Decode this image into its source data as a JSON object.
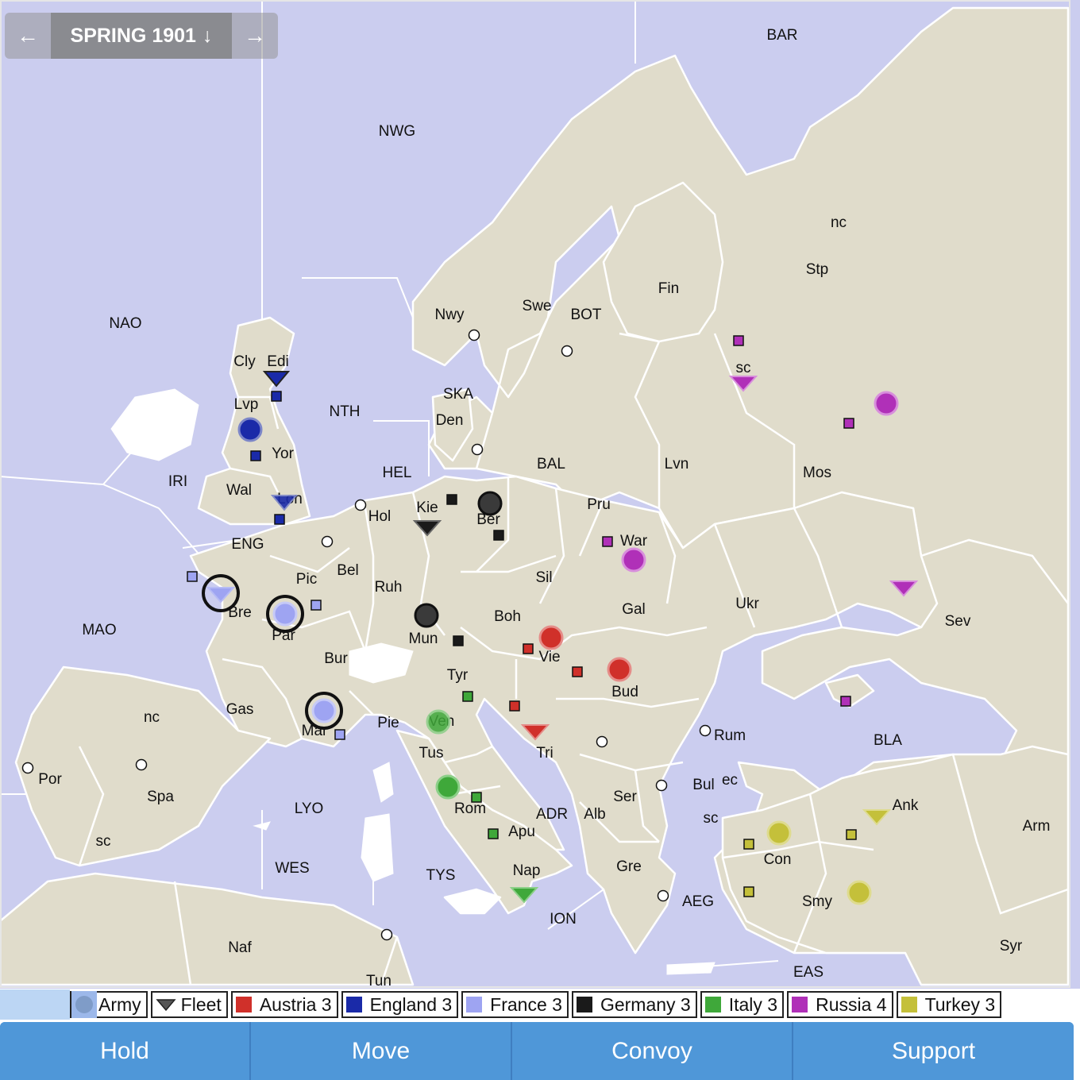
{
  "season": {
    "label": "SPRING 1901",
    "down_icon": "arrow-down-icon",
    "prev_icon": "arrow-left-icon",
    "next_icon": "arrow-right-icon"
  },
  "colors": {
    "sea": "#cbcdef",
    "land": "#e0dccb",
    "border": "#ffffff",
    "Austria": "#d0302a",
    "England": "#1a2aa8",
    "France": "#9ea4f2",
    "Germany": "#1a1a1a",
    "Italy": "#3fa83a",
    "Russia": "#b030b8",
    "Turkey": "#c4c03a"
  },
  "sea_labels": [
    "BAR",
    "NWG",
    "NAO",
    "NTH",
    "SKA",
    "HEL",
    "BAL",
    "BOT",
    "IRI",
    "ENG",
    "MAO",
    "LYO",
    "WES",
    "TYS",
    "ION",
    "ADR",
    "AEG",
    "BLA",
    "EAS"
  ],
  "land_labels": [
    "nc",
    "Stp",
    "Fin",
    "Nwy",
    "Swe",
    "sc",
    "Cly",
    "Edi",
    "Lvp",
    "Yor",
    "Den",
    "Wal",
    "Lon",
    "Hol",
    "Kie",
    "Ber",
    "Lvn",
    "Mos",
    "Pru",
    "War",
    "Pic",
    "Bel",
    "Ruh",
    "Sil",
    "Bre",
    "Par",
    "Mun",
    "Boh",
    "Gal",
    "Ukr",
    "Sev",
    "Bur",
    "Vie",
    "Tyr",
    "Bud",
    "Gas",
    "Mar",
    "Pie",
    "Ven",
    "Tri",
    "Rum",
    "nc",
    "Por",
    "Spa",
    "Tus",
    "Rom",
    "Ser",
    "Bul",
    "ec",
    "Apu",
    "Alb",
    "sc",
    "Ank",
    "Arm",
    "sc",
    "Con",
    "Nap",
    "Gre",
    "Smy",
    "Syr",
    "Naf",
    "Tun"
  ],
  "units": [
    {
      "type": "fleet",
      "power": "England",
      "province": "Edi"
    },
    {
      "type": "army",
      "power": "England",
      "province": "Lvp"
    },
    {
      "type": "fleet",
      "power": "England",
      "province": "Lon"
    },
    {
      "type": "fleet",
      "power": "France",
      "province": "Bre",
      "selected": true
    },
    {
      "type": "army",
      "power": "France",
      "province": "Par",
      "selected": true
    },
    {
      "type": "army",
      "power": "France",
      "province": "Mar",
      "selected": true
    },
    {
      "type": "fleet",
      "power": "Germany",
      "province": "Kie"
    },
    {
      "type": "army",
      "power": "Germany",
      "province": "Ber"
    },
    {
      "type": "army",
      "power": "Germany",
      "province": "Mun"
    },
    {
      "type": "army",
      "power": "Austria",
      "province": "Vie"
    },
    {
      "type": "army",
      "power": "Austria",
      "province": "Bud"
    },
    {
      "type": "fleet",
      "power": "Austria",
      "province": "Tri"
    },
    {
      "type": "army",
      "power": "Italy",
      "province": "Ven"
    },
    {
      "type": "army",
      "power": "Italy",
      "province": "Rom"
    },
    {
      "type": "fleet",
      "power": "Italy",
      "province": "Nap"
    },
    {
      "type": "fleet",
      "power": "Russia",
      "province": "Stp/sc"
    },
    {
      "type": "army",
      "power": "Russia",
      "province": "Mos"
    },
    {
      "type": "army",
      "power": "Russia",
      "province": "War"
    },
    {
      "type": "fleet",
      "power": "Russia",
      "province": "Sev"
    },
    {
      "type": "fleet",
      "power": "Turkey",
      "province": "Ank"
    },
    {
      "type": "army",
      "power": "Turkey",
      "province": "Con"
    },
    {
      "type": "army",
      "power": "Turkey",
      "province": "Smy"
    }
  ],
  "legend": {
    "army": "Army",
    "fleet": "Fleet",
    "powers": [
      {
        "name": "Austria 3",
        "color": "#d0302a"
      },
      {
        "name": "England 3",
        "color": "#1a2aa8"
      },
      {
        "name": "France 3",
        "color": "#9ea4f2"
      },
      {
        "name": "Germany 3",
        "color": "#1a1a1a"
      },
      {
        "name": "Italy 3",
        "color": "#3fa83a"
      },
      {
        "name": "Russia 4",
        "color": "#b030b8"
      },
      {
        "name": "Turkey 3",
        "color": "#c4c03a"
      }
    ]
  },
  "actions": {
    "hold": "Hold",
    "move": "Move",
    "convoy": "Convoy",
    "support": "Support"
  }
}
